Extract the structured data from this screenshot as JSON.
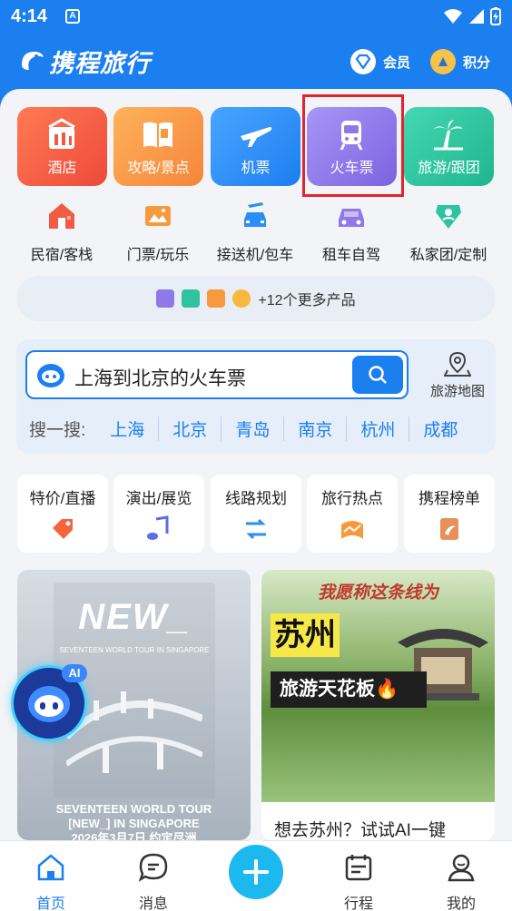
{
  "status": {
    "time": "4:14",
    "a_badge": "A"
  },
  "header": {
    "brand": "携程旅行",
    "member": "会员",
    "points": "积分"
  },
  "big_tiles": [
    {
      "label": "酒店",
      "color": "#f15a43"
    },
    {
      "label": "攻略/景点",
      "color": "#f79a3e"
    },
    {
      "label": "机票",
      "color": "#2a8ef3"
    },
    {
      "label": "火车票",
      "color": "#8f79e8"
    },
    {
      "label": "旅游/跟团",
      "color": "#2fc3a0"
    }
  ],
  "small_items": [
    {
      "label": "民宿/客栈",
      "color": "#f15a43"
    },
    {
      "label": "门票/玩乐",
      "color": "#f79a3e"
    },
    {
      "label": "接送机/包车",
      "color": "#2a8ef3"
    },
    {
      "label": "租车自驾",
      "color": "#8f79e8"
    },
    {
      "label": "私家团/定制",
      "color": "#2fc3a0"
    }
  ],
  "more_products": "+12个更多产品",
  "search": {
    "query": "上海到北京的火车票",
    "map_label": "旅游地图",
    "hot_label": "搜一搜:",
    "cities": [
      "上海",
      "北京",
      "青岛",
      "南京",
      "杭州",
      "成都"
    ]
  },
  "features": [
    "特价/直播",
    "演出/展览",
    "线路规划",
    "旅行热点",
    "携程榜单"
  ],
  "cards": {
    "left": {
      "poster_title": "NEW_",
      "poster_sub": "SEVENTEEN WORLD TOUR IN SINGAPORE",
      "caption_line1": "SEVENTEEN WORLD TOUR",
      "caption_line2": "[NEW_] IN SINGAPORE",
      "caption_line3": "2026年3月7日 约定尽洲"
    },
    "right": {
      "overlay_top": "我愿称这条线为",
      "overlay_big": "苏州",
      "overlay_sub": "旅游天花板🔥",
      "caption": "想去苏州？试试AI一键"
    }
  },
  "ai_badge": "AI",
  "tabs": [
    "首页",
    "消息",
    "行程",
    "我的"
  ],
  "colors": {
    "brand": "#1b7ff0",
    "highlight": "#e3242b"
  }
}
